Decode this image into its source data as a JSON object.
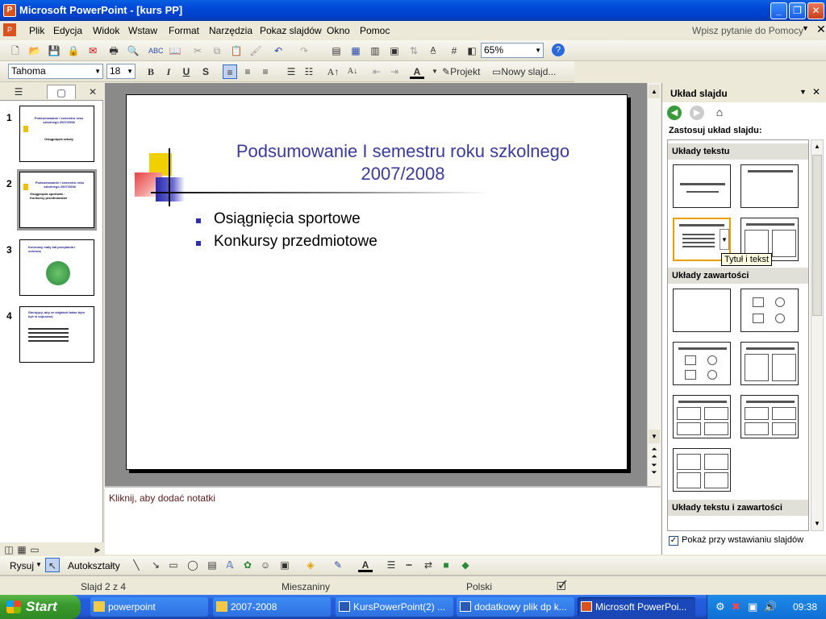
{
  "window": {
    "title": "Microsoft PowerPoint - [kurs PP]"
  },
  "menu": {
    "items": [
      "Plik",
      "Edycja",
      "Widok",
      "Wstaw",
      "Format",
      "Narzędzia",
      "Pokaz slajdów",
      "Okno",
      "Pomoc"
    ],
    "help_placeholder": "Wpisz pytanie do Pomocy"
  },
  "toolbar": {
    "zoom": "65%",
    "font": "Tahoma",
    "size": "18",
    "projekt_label": "Projekt",
    "new_slide_label": "Nowy slajd..."
  },
  "slide": {
    "title": "Podsumowanie I semestru roku szkolnego 2007/2008",
    "bullets": [
      "Osiągnięcia sportowe",
      "Konkursy przedmiotowe"
    ]
  },
  "thumbnails": [
    {
      "num": "1",
      "text": "Podsumowanie I semestru roku szkolnego 2007/2008",
      "sub": "Osiągnięcia szkoły"
    },
    {
      "num": "2",
      "text": "Podsumowanie I semestru roku szkolnego 2007/2008",
      "sub": "Osiągnięcia sportowe · Konkursy przedmiotowe"
    },
    {
      "num": "3",
      "text": "Kolorowy mały kał przepiania i ochrona",
      "sub": ""
    },
    {
      "num": "4",
      "text": "Sterujący, aby ze slajdach łatwo było być w sojusznej",
      "sub": ""
    }
  ],
  "notes": {
    "placeholder": "Kliknij, aby dodać notatki"
  },
  "taskpane": {
    "title": "Układ slajdu",
    "apply_label": "Zastosuj układ slajdu:",
    "sections": [
      "Układy tekstu",
      "Układy zawartości",
      "Układy tekstu i zawartości"
    ],
    "tooltip": "Tytuł i tekst",
    "checkbox_label": "Pokaż przy wstawianiu slajdów",
    "checkbox_checked": true
  },
  "drawbar": {
    "draw_label": "Rysuj",
    "autoshapes_label": "Autokształty"
  },
  "status": {
    "slide": "Slajd 2 z 4",
    "design": "Mieszaniny",
    "language": "Polski"
  },
  "taskbar": {
    "start": "Start",
    "tasks": [
      "powerpoint",
      "2007-2008",
      "KursPowerPoint(2) ...",
      "dodatkowy plik dp k...",
      "Microsoft PowerPoi..."
    ],
    "clock": "09:38"
  },
  "colors": {
    "title_blue": "#3a3a9a",
    "bullet_square": "#2e2eb0",
    "taskbar_blue": "#245edb",
    "start_green": "#3a9a2e"
  }
}
